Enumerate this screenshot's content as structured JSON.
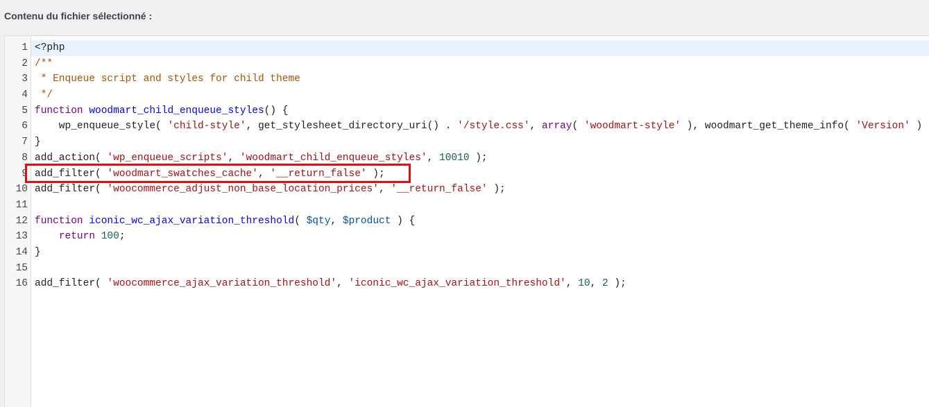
{
  "heading": "Contenu du fichier sélectionné :",
  "colors": {
    "highlight_box": "#e01010",
    "active_line": "#e8f2ff"
  },
  "lines": [
    {
      "n": "1",
      "tokens": [
        [
          "plain",
          "<?php"
        ]
      ]
    },
    {
      "n": "2",
      "tokens": [
        [
          "cm",
          "/**"
        ]
      ]
    },
    {
      "n": "3",
      "tokens": [
        [
          "cm",
          " * Enqueue script and styles for child theme"
        ]
      ]
    },
    {
      "n": "4",
      "tokens": [
        [
          "cm",
          " */"
        ]
      ]
    },
    {
      "n": "5",
      "tokens": [
        [
          "kw",
          "function"
        ],
        [
          "plain",
          " "
        ],
        [
          "def",
          "woodmart_child_enqueue_styles"
        ],
        [
          "plain",
          "() {"
        ]
      ]
    },
    {
      "n": "6",
      "tokens": [
        [
          "plain",
          "    wp_enqueue_style( "
        ],
        [
          "str",
          "'child-style'"
        ],
        [
          "plain",
          ", get_stylesheet_directory_uri() . "
        ],
        [
          "str",
          "'/style.css'"
        ],
        [
          "plain",
          ", "
        ],
        [
          "kw",
          "array"
        ],
        [
          "plain",
          "( "
        ],
        [
          "str",
          "'woodmart-style'"
        ],
        [
          "plain",
          " ), woodmart_get_theme_info( "
        ],
        [
          "str",
          "'Version'"
        ],
        [
          "plain",
          " ) );"
        ]
      ]
    },
    {
      "n": "7",
      "tokens": [
        [
          "plain",
          "}"
        ]
      ]
    },
    {
      "n": "8",
      "tokens": [
        [
          "plain",
          "add_action( "
        ],
        [
          "str",
          "'wp_enqueue_scripts'"
        ],
        [
          "plain",
          ", "
        ],
        [
          "str",
          "'woodmart_child_enqueue_styles'"
        ],
        [
          "plain",
          ", "
        ],
        [
          "num",
          "10010"
        ],
        [
          "plain",
          " );"
        ]
      ]
    },
    {
      "n": "9",
      "tokens": [
        [
          "plain",
          "add_filter( "
        ],
        [
          "str",
          "'woodmart_swatches_cache'"
        ],
        [
          "plain",
          ", "
        ],
        [
          "str",
          "'__return_false'"
        ],
        [
          "plain",
          " );"
        ]
      ]
    },
    {
      "n": "10",
      "tokens": [
        [
          "plain",
          "add_filter( "
        ],
        [
          "str",
          "'woocommerce_adjust_non_base_location_prices'"
        ],
        [
          "plain",
          ", "
        ],
        [
          "str",
          "'__return_false'"
        ],
        [
          "plain",
          " );"
        ]
      ]
    },
    {
      "n": "11",
      "tokens": []
    },
    {
      "n": "12",
      "tokens": [
        [
          "kw",
          "function"
        ],
        [
          "plain",
          " "
        ],
        [
          "def",
          "iconic_wc_ajax_variation_threshold"
        ],
        [
          "plain",
          "( "
        ],
        [
          "var",
          "$qty"
        ],
        [
          "plain",
          ", "
        ],
        [
          "var",
          "$product"
        ],
        [
          "plain",
          " ) {"
        ]
      ]
    },
    {
      "n": "13",
      "tokens": [
        [
          "plain",
          "    "
        ],
        [
          "kw",
          "return"
        ],
        [
          "plain",
          " "
        ],
        [
          "num",
          "100"
        ],
        [
          "plain",
          ";"
        ]
      ]
    },
    {
      "n": "14",
      "tokens": [
        [
          "plain",
          "}"
        ]
      ]
    },
    {
      "n": "15",
      "tokens": []
    },
    {
      "n": "16",
      "tokens": [
        [
          "plain",
          "add_filter( "
        ],
        [
          "str",
          "'woocommerce_ajax_variation_threshold'"
        ],
        [
          "plain",
          ", "
        ],
        [
          "str",
          "'iconic_wc_ajax_variation_threshold'"
        ],
        [
          "plain",
          ", "
        ],
        [
          "num",
          "10"
        ],
        [
          "plain",
          ", "
        ],
        [
          "num",
          "2"
        ],
        [
          "plain",
          " );"
        ]
      ]
    }
  ]
}
